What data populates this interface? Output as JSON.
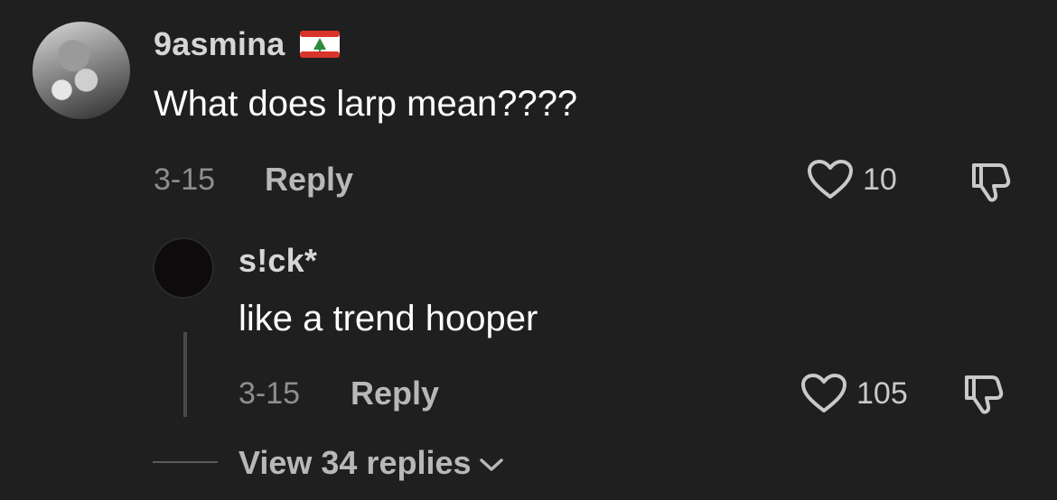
{
  "comment": {
    "username": "9asmina",
    "flag_icon": "lebanon-flag-icon",
    "text": "What does larp mean????",
    "date": "3-15",
    "reply_label": "Reply",
    "likes": "10"
  },
  "reply": {
    "username": "s!ck*",
    "text": "like a trend hooper",
    "date": "3-15",
    "reply_label": "Reply",
    "likes": "105"
  },
  "view_replies": "View 34 replies",
  "icons": {
    "like": "heart-icon",
    "dislike": "thumbs-down-icon",
    "expand": "chevron-down-icon"
  },
  "colors": {
    "background": "#1f1f1f",
    "flag_red": "#d9342b",
    "flag_green": "#2e8b3e"
  }
}
